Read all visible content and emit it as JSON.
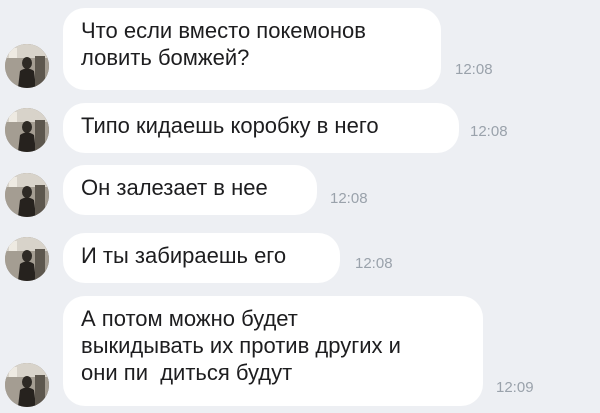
{
  "chat": {
    "messages": [
      {
        "lines": [
          "Что если вместо покемонов",
          "ловить бомжей?"
        ],
        "time": "12:08"
      },
      {
        "lines": [
          "Типо кидаешь коробку в него"
        ],
        "time": "12:08"
      },
      {
        "lines": [
          "Он залезает в нее"
        ],
        "time": "12:08"
      },
      {
        "lines": [
          "И ты забираешь его"
        ],
        "time": "12:08"
      },
      {
        "lines": [
          "А потом можно будет",
          "выкидывать их против других и",
          "они пи  диться будут"
        ],
        "time": "12:09"
      }
    ]
  },
  "colors": {
    "background": "#edeff3",
    "bubble": "#ffffff",
    "text": "#1d1d1f",
    "timestamp": "#9aa2ab"
  },
  "icons": {
    "avatar": "user-avatar-photo"
  }
}
